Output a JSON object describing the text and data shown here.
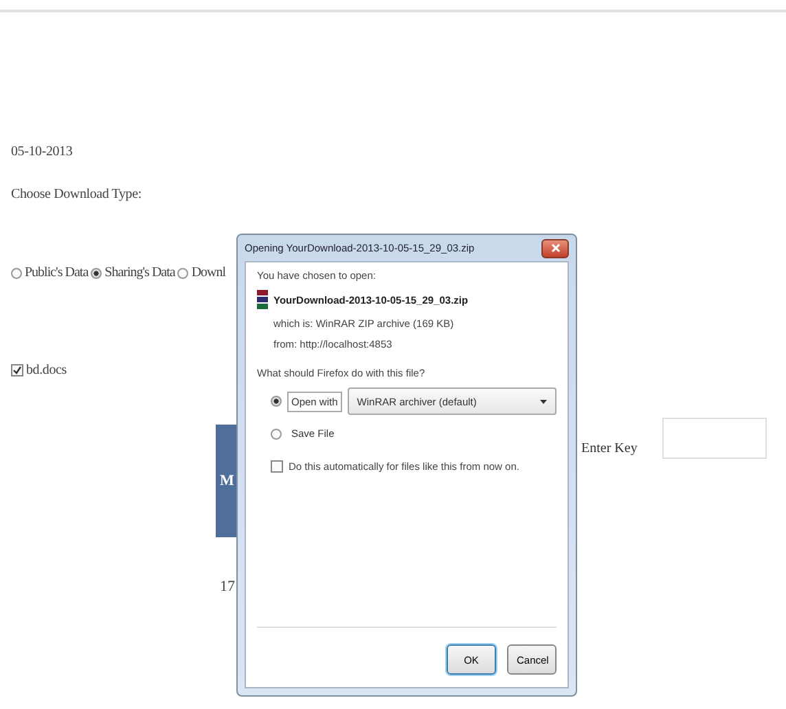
{
  "page": {
    "date": "05-10-2013",
    "prompt": "Choose Download Type:",
    "download_types": [
      {
        "label": "Public's Data",
        "selected": false
      },
      {
        "label": "Sharing's Data",
        "selected": true
      },
      {
        "label": "Downl",
        "selected": false
      }
    ],
    "docs_checkbox": {
      "label": "bd.docs",
      "checked": true
    },
    "table": {
      "header": "M",
      "cell": "17"
    },
    "key_field": {
      "label": "Enter Key"
    }
  },
  "dialog": {
    "title": "Opening YourDownload-2013-10-05-15_29_03.zip",
    "intro": "You have chosen to open:",
    "file_name": "YourDownload-2013-10-05-15_29_03.zip",
    "type_line": "which is:  WinRAR ZIP archive (169 KB)",
    "from_line": "from:  http://localhost:4853",
    "question": "What should Firefox do with this file?",
    "actions": [
      {
        "kind": "open",
        "label": "Open with",
        "selected": true,
        "app": "WinRAR archiver (default)"
      },
      {
        "kind": "save",
        "label": "Save File",
        "selected": false
      }
    ],
    "auto_checkbox": {
      "label": "Do this automatically for files like this from now on.",
      "checked": false
    },
    "buttons": [
      {
        "label": "OK",
        "default": true
      },
      {
        "label": "Cancel",
        "default": false
      }
    ]
  }
}
